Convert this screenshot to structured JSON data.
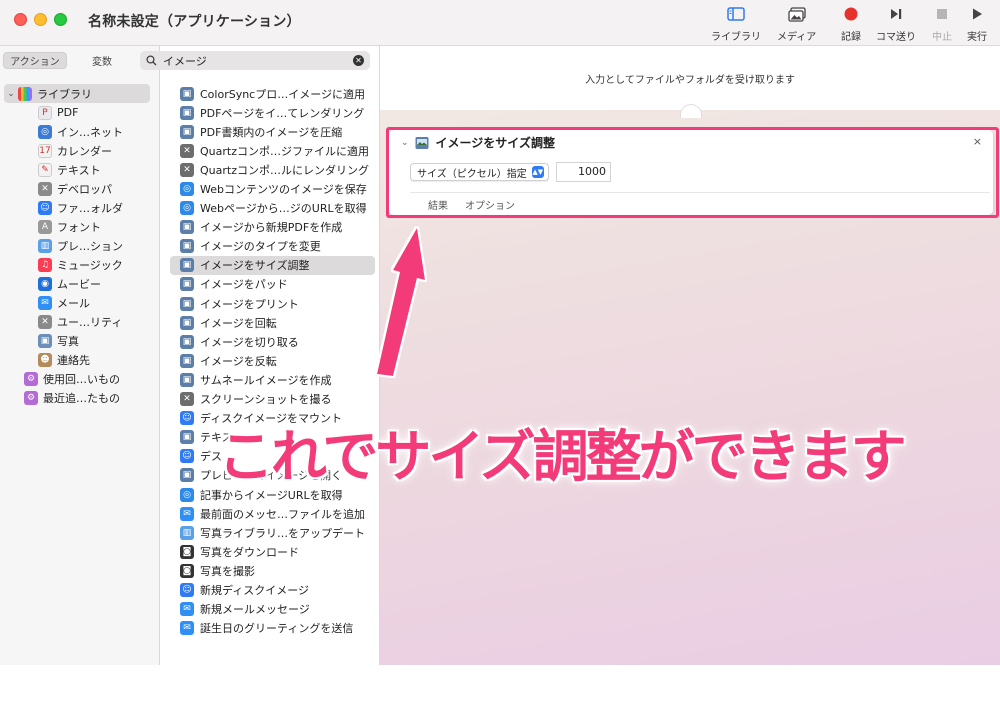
{
  "window": {
    "title": "名称未設定（アプリケーション）"
  },
  "toolbar": {
    "library_label": "ライブラリ",
    "media_label": "メディア",
    "record_label": "記録",
    "step_label": "コマ送り",
    "stop_label": "中止",
    "run_label": "実行"
  },
  "colors": {
    "accent": "#f23b78",
    "record": "#e5322d",
    "select_blue": "#2f7bf5"
  },
  "sidebar": {
    "tab_actions": "アクション",
    "tab_variables": "変数",
    "search_value": "イメージ",
    "library_root": "ライブラリ",
    "items": [
      {
        "label": "PDF",
        "icon": "pdf-icon",
        "color": "#e9e9ee"
      },
      {
        "label": "イン…ネット",
        "icon": "globe-icon",
        "color": "#3a7bd5"
      },
      {
        "label": "カレンダー",
        "icon": "calendar-icon",
        "color": "#f2f2f2"
      },
      {
        "label": "テキスト",
        "icon": "text-icon",
        "color": "#f2f2f2"
      },
      {
        "label": "デベロッパ",
        "icon": "tools-icon",
        "color": "#8a8a8a"
      },
      {
        "label": "ファ…ォルダ",
        "icon": "finder-icon",
        "color": "#2f7bf5"
      },
      {
        "label": "フォント",
        "icon": "font-icon",
        "color": "#999999"
      },
      {
        "label": "プレ…ション",
        "icon": "presentation-icon",
        "color": "#5aa0e8"
      },
      {
        "label": "ミュージック",
        "icon": "music-icon",
        "color": "#fa3c55"
      },
      {
        "label": "ムービー",
        "icon": "movie-icon",
        "color": "#1f6fd6"
      },
      {
        "label": "メール",
        "icon": "mail-icon",
        "color": "#2f8ff5"
      },
      {
        "label": "ユー…リティ",
        "icon": "utility-icon",
        "color": "#8a8a8a"
      },
      {
        "label": "写真",
        "icon": "photo-icon",
        "color": "#6b8fb7"
      },
      {
        "label": "連絡先",
        "icon": "contacts-icon",
        "color": "#b68a5a"
      }
    ],
    "smart_groups": [
      {
        "label": "使用回…いもの",
        "icon": "smart-folder-icon",
        "color": "#b36bd6"
      },
      {
        "label": "最近追…たもの",
        "icon": "smart-folder-icon",
        "color": "#b36bd6"
      }
    ]
  },
  "actions": {
    "selected_index": 9,
    "items": [
      {
        "label": "ColorSyncプロ…イメージに適用",
        "icon": "image-action-icon",
        "color": "#5b7fa8"
      },
      {
        "label": "PDFページをイ…てレンダリング",
        "icon": "image-action-icon",
        "color": "#5b7fa8"
      },
      {
        "label": "PDF書類内のイメージを圧縮",
        "icon": "image-action-icon",
        "color": "#5b7fa8"
      },
      {
        "label": "Quartzコンポ…ジファイルに適用",
        "icon": "tools-icon",
        "color": "#6d6d6d"
      },
      {
        "label": "Quartzコンポ…ルにレンダリング",
        "icon": "tools-icon",
        "color": "#6d6d6d"
      },
      {
        "label": "Webコンテンツのイメージを保存",
        "icon": "safari-icon",
        "color": "#2d8ae8"
      },
      {
        "label": "Webページから…ジのURLを取得",
        "icon": "safari-icon",
        "color": "#2d8ae8"
      },
      {
        "label": "イメージから新規PDFを作成",
        "icon": "image-action-icon",
        "color": "#5b7fa8"
      },
      {
        "label": "イメージのタイプを変更",
        "icon": "image-action-icon",
        "color": "#5b7fa8"
      },
      {
        "label": "イメージをサイズ調整",
        "icon": "image-action-icon",
        "color": "#5b7fa8"
      },
      {
        "label": "イメージをパッド",
        "icon": "image-action-icon",
        "color": "#5b7fa8"
      },
      {
        "label": "イメージをプリント",
        "icon": "image-action-icon",
        "color": "#5b7fa8"
      },
      {
        "label": "イメージを回転",
        "icon": "image-action-icon",
        "color": "#5b7fa8"
      },
      {
        "label": "イメージを切り取る",
        "icon": "image-action-icon",
        "color": "#5b7fa8"
      },
      {
        "label": "イメージを反転",
        "icon": "image-action-icon",
        "color": "#5b7fa8"
      },
      {
        "label": "サムネールイメージを作成",
        "icon": "image-action-icon",
        "color": "#5b7fa8"
      },
      {
        "label": "スクリーンショットを撮る",
        "icon": "tools-icon",
        "color": "#6d6d6d"
      },
      {
        "label": "ディスクイメージをマウント",
        "icon": "finder-icon",
        "color": "#2f7bf5"
      },
      {
        "label": "テキス",
        "icon": "image-action-icon",
        "color": "#5b7fa8"
      },
      {
        "label": "デス",
        "icon": "finder-icon",
        "color": "#2f7bf5"
      },
      {
        "label": "プレビューでイメージを開く",
        "icon": "image-action-icon",
        "color": "#5b7fa8"
      },
      {
        "label": "記事からイメージURLを取得",
        "icon": "safari-icon",
        "color": "#2d8ae8"
      },
      {
        "label": "最前面のメッセ…ファイルを追加",
        "icon": "mail-icon",
        "color": "#2f8ff5"
      },
      {
        "label": "写真ライブラリ…をアップデート",
        "icon": "presentation-icon",
        "color": "#5aa0e8"
      },
      {
        "label": "写真をダウンロード",
        "icon": "camera-icon",
        "color": "#333333"
      },
      {
        "label": "写真を撮影",
        "icon": "camera-icon",
        "color": "#333333"
      },
      {
        "label": "新規ディスクイメージ",
        "icon": "finder-icon",
        "color": "#2f7bf5"
      },
      {
        "label": "新規メールメッセージ",
        "icon": "mail-icon",
        "color": "#2f8ff5"
      },
      {
        "label": "誕生日のグリーティングを送信",
        "icon": "mail-icon",
        "color": "#2f8ff5"
      }
    ]
  },
  "workflow": {
    "input_hint": "入力としてファイルやフォルダを受け取ります",
    "card": {
      "title": "イメージをサイズ調整",
      "close": "×",
      "mode_select": "サイズ（ピクセル）指定",
      "size_value": "1000",
      "tab_results": "結果",
      "tab_options": "オプション"
    }
  },
  "annotation": {
    "text": "これでサイズ調整ができます"
  }
}
